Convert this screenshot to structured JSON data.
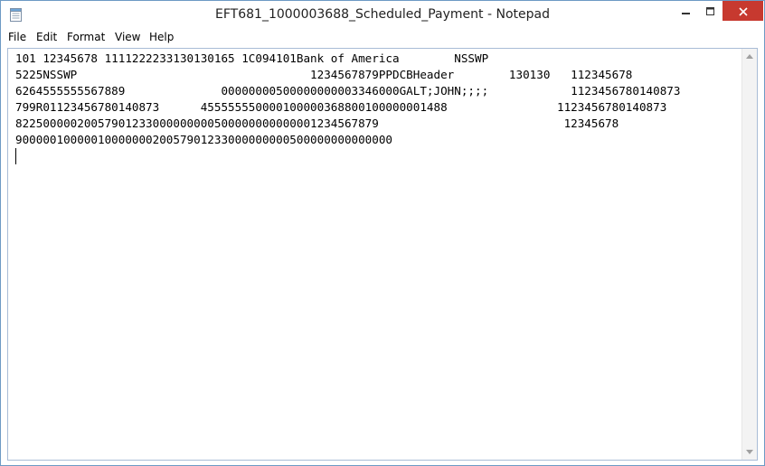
{
  "window": {
    "title": "EFT681_1000003688_Scheduled_Payment - Notepad"
  },
  "menu": {
    "items": [
      "File",
      "Edit",
      "Format",
      "View",
      "Help"
    ]
  },
  "editor": {
    "lines": [
      "101 12345678 1111222233130130165 1C094101Bank of America        NSSWP",
      "5225NSSWP                                  1234567879PPDCBHeader        130130   112345678",
      "6264555555567889              00000000500000000003346000GALT;JOHN;;;;            1123456780140873",
      "799R01123456780140873      455555550000100000368800100000001488                1123456780140873",
      "82250000020057901233000000000500000000000001234567879                           12345678",
      "9000001000001000000020057901233000000000500000000000000"
    ]
  },
  "colors": {
    "close_button_bg": "#c7392f",
    "editor_border": "#a9bcd6",
    "window_border": "#6d9ac4"
  },
  "icons": [
    "notepad-icon",
    "minimize-icon",
    "maximize-icon",
    "close-icon",
    "scroll-up-arrow-icon",
    "scroll-down-arrow-icon"
  ]
}
